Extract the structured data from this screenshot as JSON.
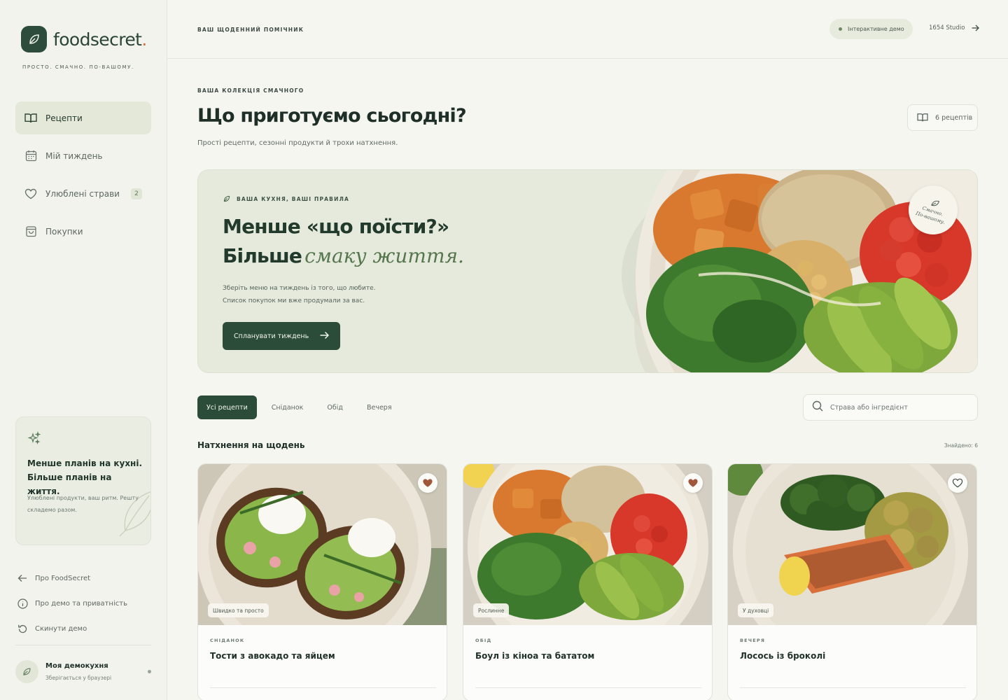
{
  "brand": {
    "name": "foodsecret",
    "dot": ".",
    "tagline": "ПРОСТО. СМАЧНО. ПО-ВАШОМУ."
  },
  "sidebar": {
    "items": [
      {
        "label": "Рецепти",
        "icon": "book-icon",
        "active": true
      },
      {
        "label": "Мій тиждень",
        "icon": "calendar-icon"
      },
      {
        "label": "Улюблені страви",
        "icon": "heart-icon",
        "badge": "2"
      },
      {
        "label": "Покупки",
        "icon": "shopping-bag-icon"
      }
    ],
    "promo": {
      "title": "Менше планів на кухні. Більше планів на життя.",
      "text": "Улюблені продукти, ваш ритм. Решту складемо разом."
    },
    "links": [
      {
        "label": "Про FoodSecret",
        "icon": "arrow-left-icon"
      },
      {
        "label": "Про демо та приватність",
        "icon": "info-icon"
      },
      {
        "label": "Скинути демо",
        "icon": "reset-icon"
      }
    ],
    "user": {
      "name": "Моя демокухня",
      "sub": "Зберігається у браузері"
    }
  },
  "topbar": {
    "eyebrow": "ВАШ ЩОДЕННИЙ ПОМІЧНИК",
    "demo_pill": "Інтерактивне демо",
    "studio": "1654 Studio"
  },
  "main": {
    "eyebrow": "ВАША КОЛЕКЦІЯ СМАЧНОГО",
    "title": "Що приготуємо сьогодні?",
    "subtitle": "Прості рецепти, сезонні продукти й трохи натхнення.",
    "count_label": "6 рецептів"
  },
  "hero": {
    "eyebrow": "ВАША КУХНЯ, ВАШІ ПРАВИЛА",
    "line1": "Менше «що поїсти?»",
    "line2_plain": "Більше",
    "line2_accent": "смаку життя.",
    "desc1": "Зберіть меню на тиждень із того, що любите.",
    "desc2": "Список покупок ми вже продумали за вас.",
    "cta": "Спланувати тиждень",
    "stamp_line1": "Смачно.",
    "stamp_line2": "По-вашому."
  },
  "filters": {
    "tabs": [
      "Усі рецепти",
      "Сніданок",
      "Обід",
      "Вечеря"
    ],
    "active_index": 0,
    "search_placeholder": "Страва або інгредієнт"
  },
  "section": {
    "title": "Натхнення на щодень",
    "found": "Знайдено: 6"
  },
  "cards": [
    {
      "meal": "СНІДАНОК",
      "name": "Тости з авокадо та яйцем",
      "tag": "Швидко та просто",
      "favorited": true
    },
    {
      "meal": "ОБІД",
      "name": "Боул із кіноа та бататом",
      "tag": "Рослинне",
      "favorited": true
    },
    {
      "meal": "ВЕЧЕРЯ",
      "name": "Лосось із броколі",
      "tag": "У духовці",
      "favorited": false
    }
  ],
  "colors": {
    "accent": "#2c4c3a",
    "hero_bg": "#e5eadc",
    "page_bg": "#f6f6f1",
    "fav": "#a0563a",
    "brand_dot": "#d46b3a"
  }
}
